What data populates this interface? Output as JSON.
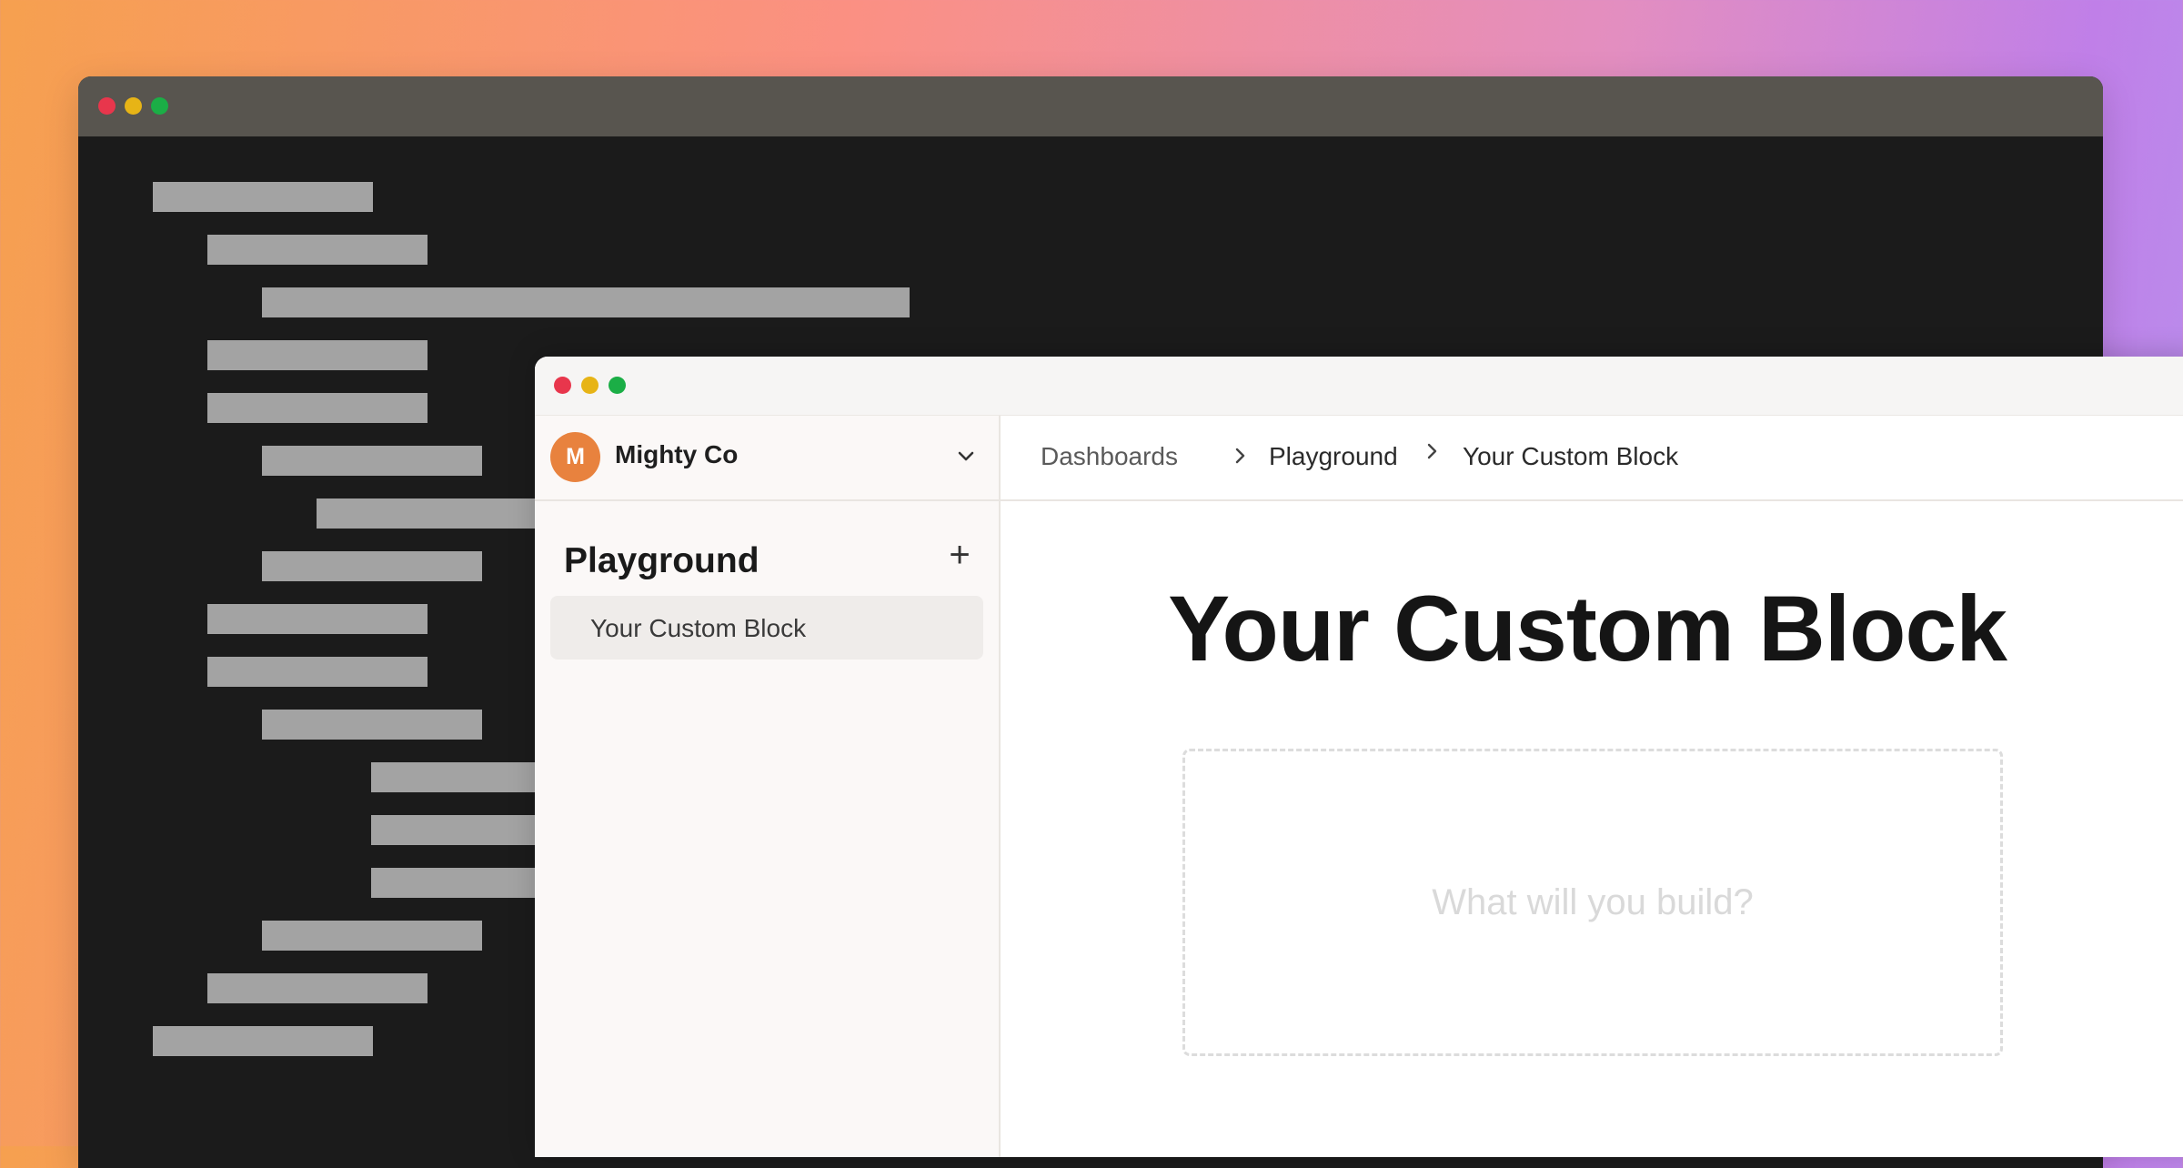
{
  "colors": {
    "traffic_red": "#e8364c",
    "traffic_yellow": "#e7b416",
    "traffic_green": "#1bae46",
    "avatar": "#e8823e",
    "code_placeholder": "#a3a3a3"
  },
  "editor": {
    "titlebar_buttons": [
      "close",
      "minimize",
      "maximize"
    ]
  },
  "app": {
    "workspace": {
      "avatar_initial": "M",
      "name": "Mighty Co",
      "dropdown_icon": "chevron-down-icon"
    },
    "sidebar": {
      "heading": "Playground",
      "add_icon": "plus-icon",
      "add_label": "+",
      "items": [
        {
          "label": "Your Custom Block",
          "selected": true
        }
      ]
    },
    "breadcrumb": {
      "items": [
        "Dashboards",
        "Playground",
        "Your Custom Block"
      ],
      "separator_icon": "chevron-right-icon"
    },
    "main": {
      "title": "Your Custom Block",
      "placeholder": "What will you build?"
    }
  }
}
